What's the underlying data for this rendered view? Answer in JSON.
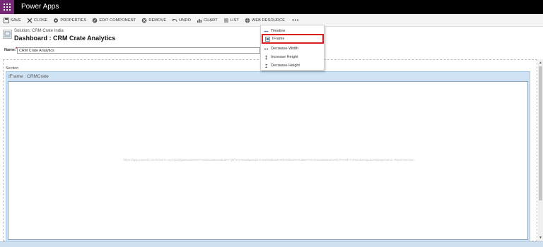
{
  "app": {
    "title": "Power Apps"
  },
  "toolbar": {
    "save": "SAVE",
    "close": "CLOSE",
    "properties": "PROPERTIES",
    "edit_component": "EDIT COMPONENT",
    "remove": "REMOVE",
    "undo": "UNDO",
    "chart": "CHART",
    "list": "LIST",
    "web_resource": "WEB RESOURCE",
    "more": "•••"
  },
  "header": {
    "solution": "Solution: CRM Crate India",
    "title": "Dashboard : CRM Crate Analytics"
  },
  "name_field": {
    "label": "Name",
    "required_mark": "*",
    "value": "CRM Crate Analytics"
  },
  "canvas": {
    "section_label": "Section",
    "iframe_label": "IFrame : CRMCrate",
    "iframe_url": "https://app.powerbi.com/view?r=eyJrIjoiZjQ0OGI2MWItYmNlZC00NzU3LWIzYjktYmVmNDhjZGZhYmIwIiwidCI6ImRkMzllZmNmLWE5YmUtNGJiMS04ZmRlLTFmMzYxNDY5ZTQ1ZiJ9&pageName=ReportSection"
  },
  "dropdown": {
    "items": [
      {
        "label": "Timeline",
        "icon": "timeline-icon"
      },
      {
        "label": "IFrame",
        "icon": "iframe-icon"
      },
      {
        "label": "Decrease Width",
        "icon": "decrease-width-icon"
      },
      {
        "label": "Increase Height",
        "icon": "increase-height-icon"
      },
      {
        "label": "Decrease Height",
        "icon": "decrease-height-icon"
      }
    ]
  },
  "colors": {
    "appbar": "#000000",
    "waffle": "#742774",
    "highlight": "#d81e1e",
    "section_fill": "#cfe3f5"
  }
}
